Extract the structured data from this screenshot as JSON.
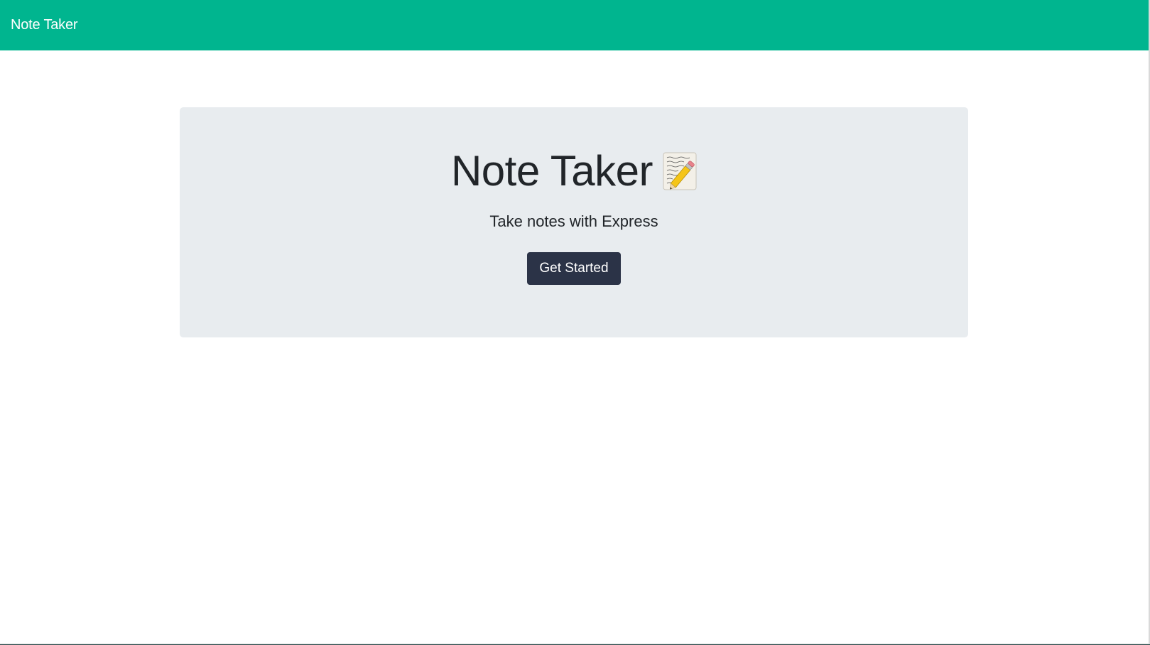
{
  "navbar": {
    "brand": "Note Taker",
    "color": "#00b58f"
  },
  "hero": {
    "title": "Note Taker",
    "icon": "memo-icon",
    "subtitle": "Take notes with Express",
    "button_label": "Get Started",
    "background": "#e8ecef",
    "button_color": "#2b3347"
  }
}
